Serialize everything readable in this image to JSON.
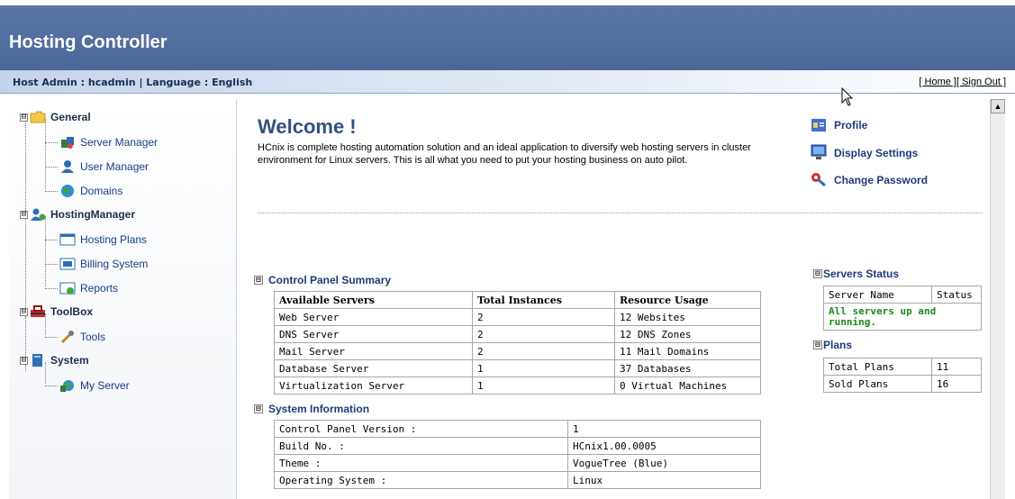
{
  "app": {
    "title": "Hosting Controller"
  },
  "subbar": {
    "user_info": "Host Admin : hcadmin | Language : English",
    "home_link": "[ Home ]",
    "signout_link": "[ Sign Out ]"
  },
  "sidebar": {
    "groups": [
      {
        "label": "General",
        "icon": "folder-icon",
        "items": [
          {
            "label": "Server Manager",
            "icon": "server-manager-icon"
          },
          {
            "label": "User Manager",
            "icon": "user-icon"
          },
          {
            "label": "Domains",
            "icon": "globe-icon"
          }
        ]
      },
      {
        "label": "HostingManager",
        "icon": "hosting-manager-icon",
        "items": [
          {
            "label": "Hosting Plans",
            "icon": "window-icon"
          },
          {
            "label": "Billing System",
            "icon": "billing-icon"
          },
          {
            "label": "Reports",
            "icon": "reports-icon"
          }
        ]
      },
      {
        "label": "ToolBox",
        "icon": "toolbox-icon",
        "items": [
          {
            "label": "Tools",
            "icon": "tools-icon"
          }
        ]
      },
      {
        "label": "System",
        "icon": "system-icon",
        "items": [
          {
            "label": "My Server",
            "icon": "my-server-icon"
          }
        ]
      }
    ]
  },
  "main": {
    "welcome_title": "Welcome !",
    "intro": "HCnix is complete hosting automation solution and an ideal application to diversify web hosting servers in cluster environment for Linux servers. This is all what you need to put your hosting business on auto pilot.",
    "quick_links": [
      {
        "label": "Profile",
        "icon": "profile-icon"
      },
      {
        "label": "Display Settings",
        "icon": "monitor-icon"
      },
      {
        "label": "Change Password",
        "icon": "key-icon"
      }
    ],
    "control_panel": {
      "title": "Control Panel Summary",
      "headers": [
        "Available Servers",
        "Total Instances",
        "Resource Usage"
      ],
      "rows": [
        [
          "Web Server",
          "2",
          "12 Websites"
        ],
        [
          "DNS Server",
          "2",
          "12 DNS Zones"
        ],
        [
          "Mail Server",
          "2",
          "11 Mail Domains"
        ],
        [
          "Database Server",
          "1",
          "37 Databases"
        ],
        [
          "Virtualization Server",
          "1",
          "0 Virtual Machines"
        ]
      ]
    },
    "system_info": {
      "title": "System Information",
      "rows": [
        [
          "Control Panel Version :",
          "1"
        ],
        [
          "Build No. :",
          "HCnix1.00.0005"
        ],
        [
          "Theme :",
          "VogueTree (Blue)"
        ],
        [
          "Operating System :",
          "Linux"
        ]
      ]
    },
    "servers_status": {
      "title": "Servers Status",
      "headers": [
        "Server Name",
        "Status"
      ],
      "message": "All servers up and running."
    },
    "plans": {
      "title": "Plans",
      "rows": [
        [
          "Total Plans",
          "11"
        ],
        [
          "Sold Plans",
          "16"
        ]
      ]
    }
  },
  "toggles": {
    "collapse": "⊟"
  }
}
